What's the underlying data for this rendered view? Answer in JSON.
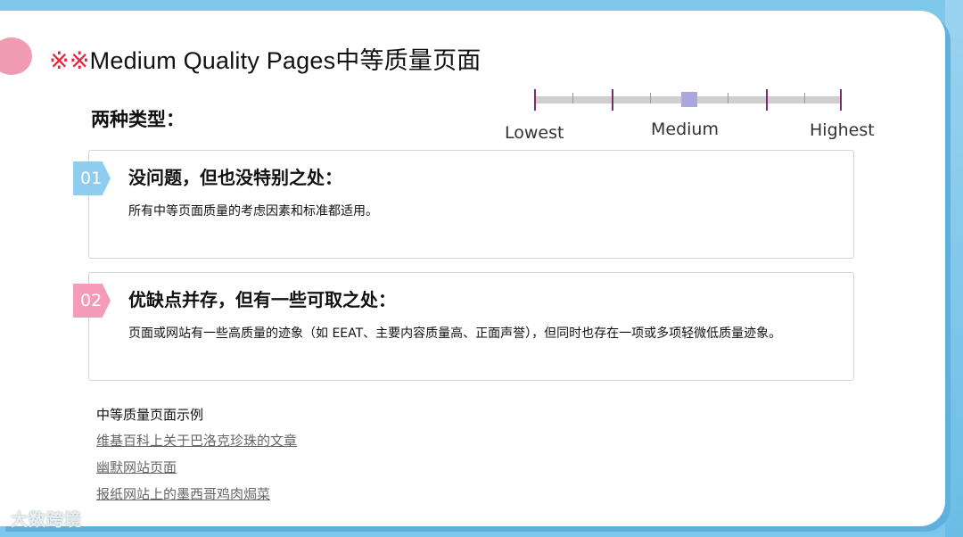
{
  "slide": {
    "title_mark": "※※",
    "title_text": "Medium Quality Pages中等质量页面",
    "subhead": "两种类型："
  },
  "scale": {
    "lowest": "Lowest",
    "medium": "Medium",
    "highest": "Highest",
    "level": 0.5
  },
  "cards": [
    {
      "badge": "01",
      "title": "没问题，但也没特别之处：",
      "body": "所有中等页面质量的考虑因素和标准都适用。"
    },
    {
      "badge": "02",
      "title": "优缺点并存，但有一些可取之处：",
      "body": "页面或网站有一些高质量的迹象（如 EEAT、主要内容质量高、正面声誉），但同时也存在一项或多项轻微低质量迹象。"
    }
  ],
  "examples": {
    "title": "中等质量页面示例",
    "links": [
      "维基百科上关于巴洛克珍珠的文章",
      "幽默网站页面",
      "报纸网站上的墨西哥鸡肉焗菜"
    ]
  },
  "watermark": "大数跨境",
  "colors": {
    "accent_blue": "#8fcdf0",
    "accent_pink": "#f49bb7",
    "title_mark": "#e8233a"
  }
}
